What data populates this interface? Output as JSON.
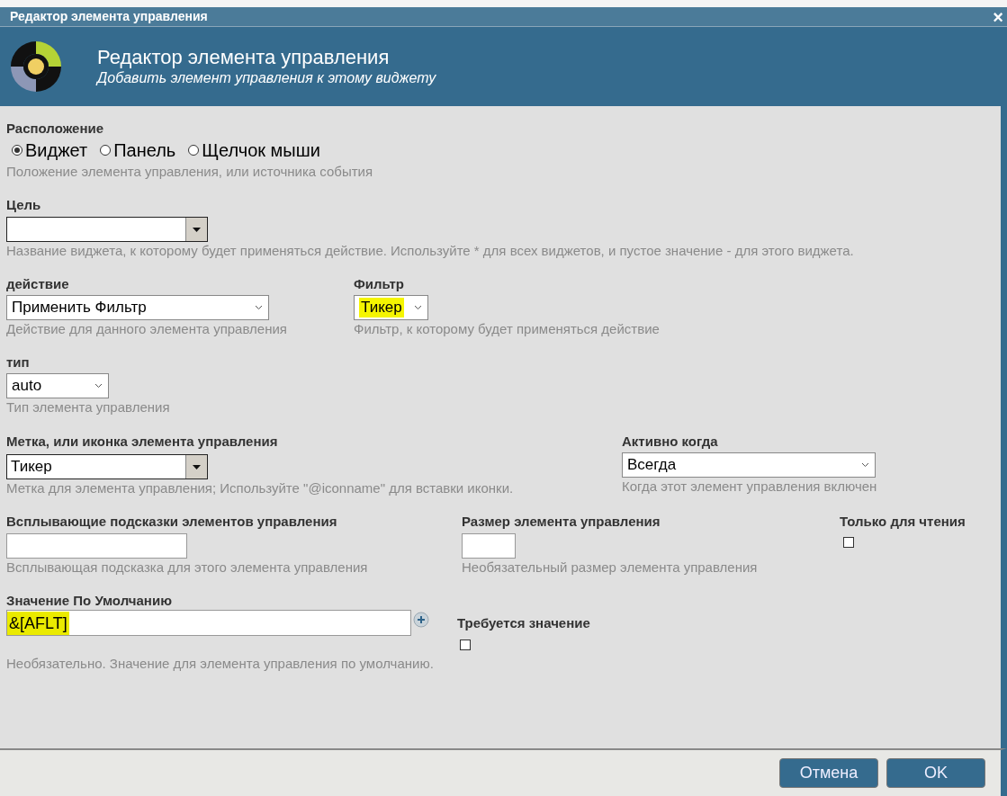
{
  "dialog": {
    "title": "Редактор элемента управления",
    "close": "×",
    "header": {
      "title": "Редактор элемента управления",
      "subtitle": "Добавить элемент управления к этому виджету"
    },
    "location": {
      "label": "Расположение",
      "options": [
        {
          "label": "Виджет",
          "selected": true
        },
        {
          "label": "Панель",
          "selected": false
        },
        {
          "label": "Щелчок мыши",
          "selected": false
        }
      ],
      "help": "Положение элемента управления, или источника события"
    },
    "target": {
      "label": "Цель",
      "help": "Название виджета, к которому будет применяться действие. Используйте * для всех виджетов, и пустое значение - для этого виджета."
    },
    "action": {
      "label": "действие",
      "value": "Применить Фильтр",
      "help": "Действие для данного элемента управления"
    },
    "filter": {
      "label": "Фильтр",
      "value": "Тикер",
      "highlighted": true,
      "help": "Фильтр, к которому будет применяться действие"
    },
    "type": {
      "label": "тип",
      "value": "auto",
      "help": "Тип элемента управления"
    },
    "caption": {
      "label": "Метка, или иконка элемента управления",
      "value": "Тикер",
      "help": "Метка для элемента управления; Используйте \"@iconname\" для вставки иконки."
    },
    "active_when": {
      "label": "Активно когда",
      "value": "Всегда",
      "help": "Когда этот элемент управления включен"
    },
    "tooltip": {
      "label": "Всплывающие подсказки элементов управления",
      "help": "Всплывающая подсказка для этого элемента управления"
    },
    "size": {
      "label": "Размер элемента управления",
      "help": "Необязательный размер элемента управления"
    },
    "readonly": {
      "label": "Только для чтения",
      "checked": false
    },
    "default_value": {
      "label": "Значение По Умолчанию",
      "value": "&[AFLT]",
      "highlighted": true,
      "help": "Необязательно. Значение для элемента управления по умолчанию."
    },
    "required": {
      "label": "Требуется значение",
      "checked": false
    },
    "buttons": [
      "Отмена",
      "OK"
    ]
  }
}
